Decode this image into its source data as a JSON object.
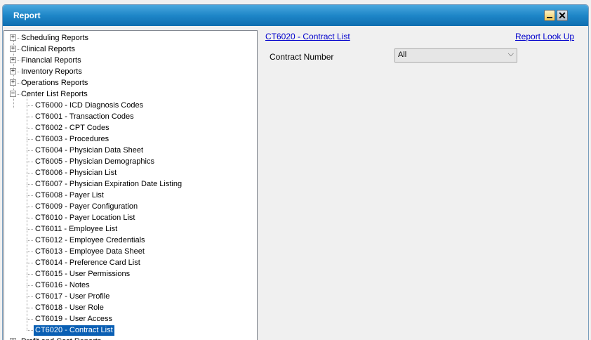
{
  "window": {
    "title": "Report"
  },
  "tree": {
    "categories": [
      {
        "label": "Scheduling Reports",
        "expanded": false
      },
      {
        "label": "Clinical Reports",
        "expanded": false
      },
      {
        "label": "Financial Reports",
        "expanded": false
      },
      {
        "label": "Inventory Reports",
        "expanded": false
      },
      {
        "label": "Operations Reports",
        "expanded": false
      },
      {
        "label": "Center List Reports",
        "expanded": true
      },
      {
        "label": "Profit and Cost Reports",
        "expanded": false
      }
    ],
    "center_list_items": [
      "CT6000 - ICD Diagnosis Codes",
      "CT6001 - Transaction Codes",
      "CT6002 - CPT Codes",
      "CT6003 - Procedures",
      "CT6004 - Physician Data Sheet",
      "CT6005 - Physician Demographics",
      "CT6006 - Physician List",
      "CT6007 - Physician Expiration Date Listing",
      "CT6008 - Payer List",
      "CT6009 - Payer Configuration",
      "CT6010 - Payer Location List",
      "CT6011 - Employee List",
      "CT6012 - Employee Credentials",
      "CT6013 - Employee Data Sheet",
      "CT6014 - Preference Card List",
      "CT6015 - User Permissions",
      "CT6016 - Notes",
      "CT6017 - User Profile",
      "CT6018 - User Role",
      "CT6019 - User Access",
      "CT6020 - Contract List"
    ],
    "selected_item": "CT6020 - Contract List"
  },
  "report": {
    "title": "CT6020 - Contract List",
    "lookup_link": "Report Look Up",
    "filter_label": "Contract Number",
    "filter_value": "All"
  },
  "icons": {
    "expander_collapsed": "plus-box-icon",
    "expander_expanded": "minus-box-icon",
    "minimize": "minimize-icon",
    "close": "close-icon"
  },
  "colors": {
    "titlebar": "#1e86c8",
    "selection": "#0a5fb4",
    "link": "#0000cc"
  }
}
